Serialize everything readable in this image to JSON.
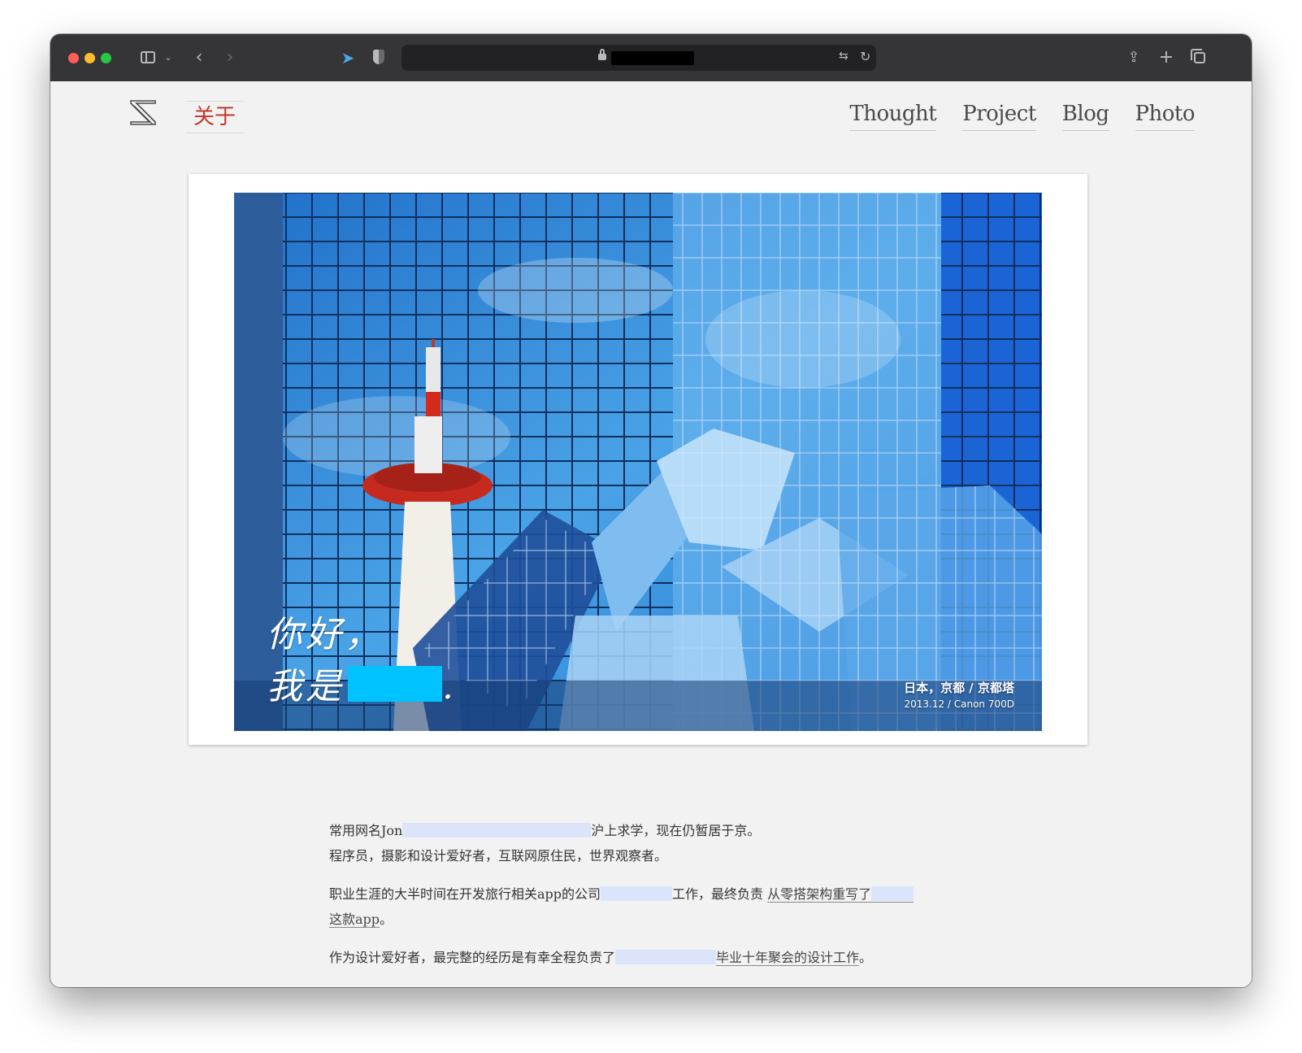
{
  "browser": {
    "url_visible": "",
    "icons": [
      "sidebar-icon",
      "chevron-down-icon",
      "back-icon",
      "forward-icon",
      "bird-icon",
      "shield-icon",
      "lock-icon",
      "translate-icon",
      "reload-icon",
      "share-icon",
      "new-tab-icon",
      "tabs-icon"
    ]
  },
  "site": {
    "about_label": "关于",
    "nav": [
      {
        "label": "Thought"
      },
      {
        "label": "Project"
      },
      {
        "label": "Blog"
      },
      {
        "label": "Photo"
      }
    ]
  },
  "hero": {
    "greeting_line1": "你好，",
    "greeting_line2_prefix": "我是",
    "greeting_line2_suffix": ".",
    "caption_location": "日本，京都 / 京都塔",
    "caption_meta": "2013.12 / Canon 700D"
  },
  "bio": {
    "p1_line1_a": "常用网名Jon",
    "p1_line1_b": "沪上求学，现在仍暂居于京。",
    "p1_line2": "程序员，摄影和设计爱好者，互联网原住民，世界观察者。",
    "p2_a": "职业生涯的大半时间在开发旅行相关app的公司",
    "p2_b": "工作，最终负责",
    "p2_link_a": "从零搭架构重写了",
    "p2_link_b": "这款app",
    "p2_end": "。",
    "p3_a": "作为设计爱好者，最完整的经历是有幸全程负责了",
    "p3_link": "毕业十年聚会的设计工作",
    "p3_end": "。"
  }
}
